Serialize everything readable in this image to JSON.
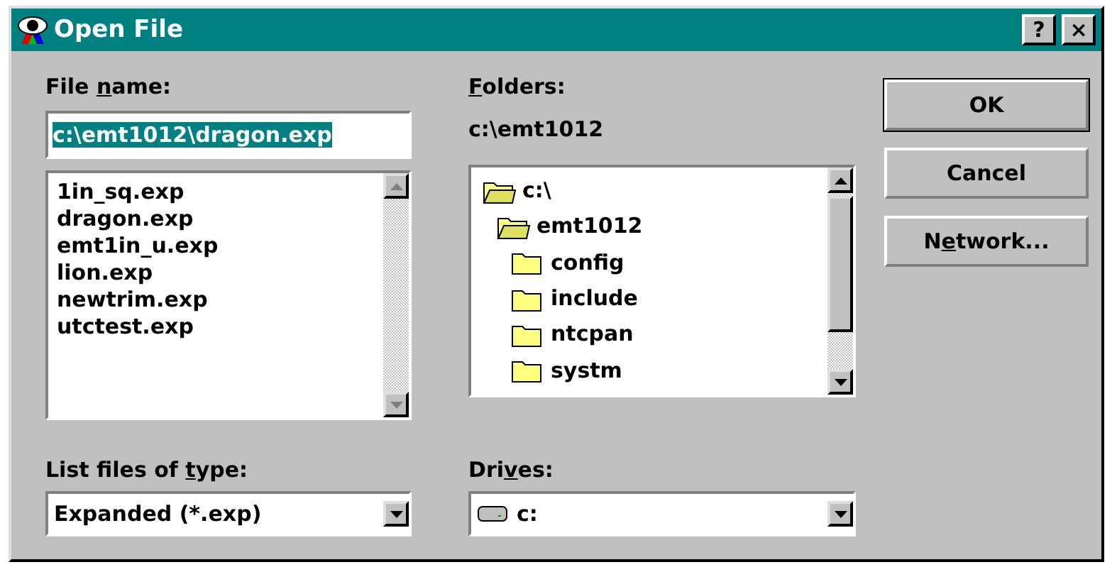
{
  "window": {
    "title": "Open File",
    "title_buttons": [
      "?",
      "×"
    ]
  },
  "file_name": {
    "label": {
      "pre": "File ",
      "key": "n",
      "post": "ame:"
    },
    "value": "c:\\emt1012\\dragon.exp",
    "selected": true
  },
  "files": [
    {
      "name": "1in_sq.exp"
    },
    {
      "name": "dragon.exp"
    },
    {
      "name": "emt1in_u.exp"
    },
    {
      "name": "lion.exp"
    },
    {
      "name": "newtrim.exp"
    },
    {
      "name": "utctest.exp"
    }
  ],
  "folders": {
    "label": {
      "key": "F",
      "post": "olders:"
    },
    "current_path": "c:\\emt1012",
    "tree": [
      {
        "name": "c:\\",
        "expanded": true,
        "children": [
          {
            "name": "emt1012",
            "expanded": true,
            "children": [
              {
                "name": "config",
                "expanded": false
              },
              {
                "name": "include",
                "expanded": false
              },
              {
                "name": "ntcpan",
                "expanded": false
              },
              {
                "name": "systm",
                "expanded": false
              }
            ]
          }
        ]
      }
    ]
  },
  "buttons": [
    {
      "label": {
        "pre": "OK"
      },
      "default": true
    },
    {
      "label": {
        "pre": "Cancel"
      },
      "default": false
    },
    {
      "label": {
        "pre": "N",
        "key": "e",
        "post": "twork..."
      },
      "default": false
    }
  ],
  "file_type": {
    "label": {
      "pre": "List files of ",
      "key": "t",
      "post": "ype:"
    },
    "value": "Expanded (*.exp)"
  },
  "drives": {
    "label": {
      "pre": "Dri",
      "key": "v",
      "post": "es:"
    },
    "value": "c:"
  }
}
